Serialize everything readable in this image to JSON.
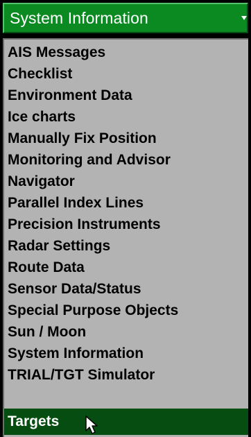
{
  "dropdown": {
    "title": "System Information",
    "icon": "chevron-down-icon"
  },
  "list": {
    "items": [
      {
        "label": "AIS Messages"
      },
      {
        "label": "Checklist"
      },
      {
        "label": "Environment Data"
      },
      {
        "label": "Ice charts"
      },
      {
        "label": "Manually Fix Position"
      },
      {
        "label": "Monitoring and Advisor"
      },
      {
        "label": "Navigator"
      },
      {
        "label": "Parallel Index Lines"
      },
      {
        "label": "Precision Instruments"
      },
      {
        "label": "Radar Settings"
      },
      {
        "label": "Route Data"
      },
      {
        "label": "Sensor Data/Status"
      },
      {
        "label": "Special Purpose Objects"
      },
      {
        "label": "Sun / Moon"
      },
      {
        "label": "System Information"
      },
      {
        "label": "TRIAL/TGT Simulator"
      },
      {
        "label": "Targets",
        "selected": true
      }
    ]
  },
  "colors": {
    "header_green": "#0b8a22",
    "selected_green": "#054d10",
    "panel_gray": "#b3b3b3"
  }
}
